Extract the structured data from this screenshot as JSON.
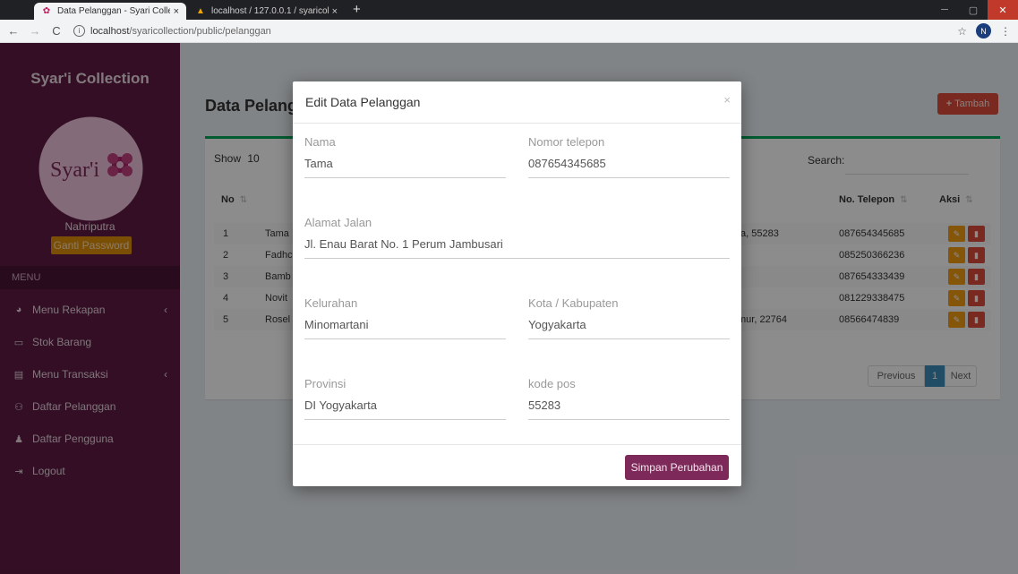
{
  "browser": {
    "tabs": [
      {
        "title": "Data Pelanggan - Syari Collectio",
        "close": "×"
      },
      {
        "title": "localhost / 127.0.0.1 / syaricollect",
        "close": "×"
      }
    ],
    "new_tab": "+",
    "url_host": "localhost",
    "url_path": "/syaricollection/public/pelanggan",
    "avatar_letter": "N"
  },
  "sidebar": {
    "brand": "Syar'i Collection",
    "logo_text": "Syar'i",
    "username": "Nahriputra",
    "ganti_password": "Ganti Password",
    "menu_header": "MENU",
    "items": [
      {
        "label": "Menu Rekapan",
        "icon": "pie-chart-icon",
        "glyph": "◕",
        "chevron": "‹"
      },
      {
        "label": "Stok Barang",
        "icon": "laptop-icon",
        "glyph": "▭",
        "chevron": ""
      },
      {
        "label": "Menu Transaksi",
        "icon": "file-icon",
        "glyph": "▤",
        "chevron": "‹"
      },
      {
        "label": "Daftar Pelanggan",
        "icon": "users-icon",
        "glyph": "⚇",
        "chevron": ""
      },
      {
        "label": "Daftar Pengguna",
        "icon": "user-icon",
        "glyph": "♟",
        "chevron": ""
      },
      {
        "label": "Logout",
        "icon": "logout-icon",
        "glyph": "⇥",
        "chevron": ""
      }
    ]
  },
  "main": {
    "page_title": "Data Pelanggan",
    "tambah_label": "Tambah",
    "show_label": "Show",
    "show_value": "10",
    "search_label": "Search:",
    "columns": {
      "no": "No",
      "telepon": "No. Telepon",
      "aksi": "Aksi"
    },
    "rows": [
      {
        "no": "1",
        "nama": "Tama",
        "alamat": "ta, 55283",
        "telepon": "087654345685"
      },
      {
        "no": "2",
        "nama": "Fadhc",
        "alamat": "",
        "telepon": "085250366236"
      },
      {
        "no": "3",
        "nama": "Bamb",
        "alamat": "",
        "telepon": "087654333439"
      },
      {
        "no": "4",
        "nama": "Novit",
        "alamat": "",
        "telepon": "081229338475"
      },
      {
        "no": "5",
        "nama": "Rosel",
        "alamat": "mur, 22764",
        "telepon": "08566474839"
      }
    ],
    "pager": {
      "previous": "Previous",
      "current": "1",
      "next": "Next"
    }
  },
  "modal": {
    "title": "Edit Data Pelanggan",
    "close": "×",
    "fields": {
      "nama": {
        "label": "Nama",
        "value": "Tama"
      },
      "telepon": {
        "label": "Nomor telepon",
        "value": "087654345685"
      },
      "alamat": {
        "label": "Alamat Jalan",
        "value": "Jl. Enau Barat No. 1 Perum Jambusari"
      },
      "kelurahan": {
        "label": "Kelurahan",
        "value": "Minomartani"
      },
      "kota": {
        "label": "Kota / Kabupaten",
        "value": "Yogyakarta"
      },
      "provinsi": {
        "label": "Provinsi",
        "value": "DI Yogyakarta"
      },
      "kodepos": {
        "label": "kode pos",
        "value": "55283"
      }
    },
    "submit_label": "Simpan Perubahan"
  }
}
